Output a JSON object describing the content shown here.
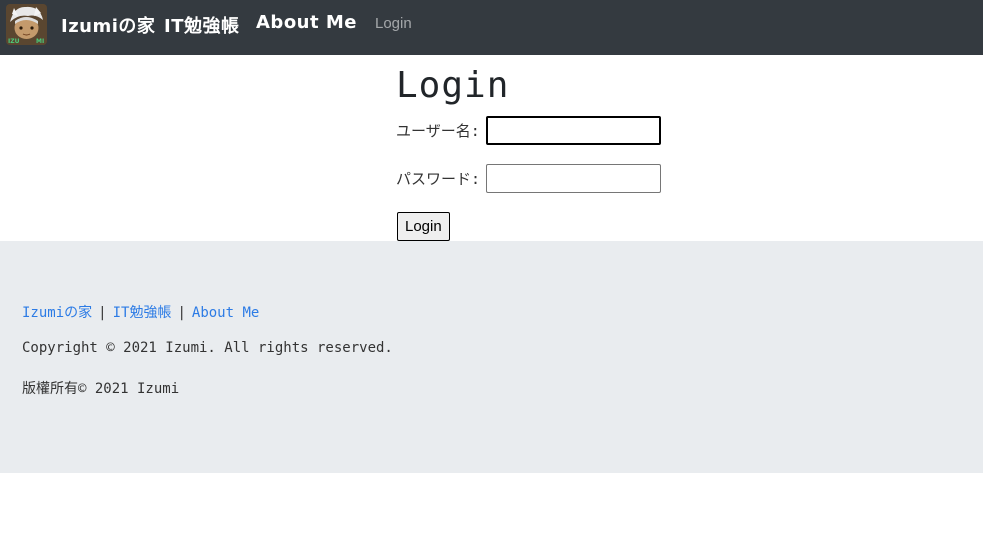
{
  "navbar": {
    "logo_text_left": "IZU",
    "logo_text_right": "MI",
    "brand_label": "Izumiの家",
    "it_label": "IT勉強帳",
    "about_label": "About Me",
    "login_label": "Login"
  },
  "main": {
    "title": "Login",
    "username_label": "ユーザー名:",
    "username_value": "",
    "password_label": "パスワード:",
    "password_value": "",
    "submit_label": "Login"
  },
  "footer": {
    "links": [
      "Izumiの家",
      "IT勉強帳",
      "About Me"
    ],
    "separator": "|",
    "copyright": "Copyright © 2021 Izumi. All rights reserved.",
    "copyright_jp": "版權所有© 2021 Izumi"
  },
  "colors": {
    "navbar_bg": "#343a40",
    "footer_bg": "#e9ecef",
    "link": "#2c7be5"
  }
}
